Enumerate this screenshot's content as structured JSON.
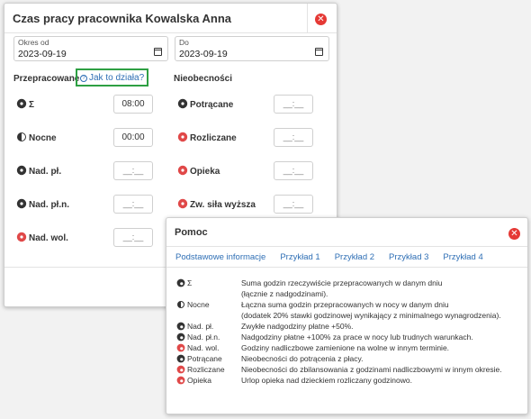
{
  "dialog": {
    "title": "Czas pracy pracownika Kowalska Anna",
    "close_icon": "close-icon",
    "from": {
      "label": "Okres od",
      "value": "2023-09-19"
    },
    "to": {
      "label": "Do",
      "value": "2023-09-19"
    },
    "worked_title": "Przepracowane",
    "help_link": "Jak to działa?",
    "absences_title": "Nieobecności",
    "worked_rows": [
      {
        "label": "Σ",
        "icon": "gear-icon",
        "value": "08:00"
      },
      {
        "label": "Nocne",
        "icon": "half-circle-icon",
        "value": "00:00"
      },
      {
        "label": "Nad. pł.",
        "icon": "gear-icon",
        "value": "__:__"
      },
      {
        "label": "Nad. pł.n.",
        "icon": "gear-icon",
        "value": "__:__"
      },
      {
        "label": "Nad. wol.",
        "icon": "red-gear-icon",
        "value": "__:__"
      }
    ],
    "absence_rows": [
      {
        "label": "Potrącane",
        "icon": "gear-icon",
        "value": "__:__"
      },
      {
        "label": "Rozliczane",
        "icon": "red-gear-icon",
        "value": "__:__"
      },
      {
        "label": "Opieka",
        "icon": "red-gear-icon",
        "value": "__:__"
      },
      {
        "label": "Zw. siła wyższa",
        "icon": "red-gear-icon",
        "value": "__:__"
      }
    ]
  },
  "help": {
    "title": "Pomoc",
    "tabs": [
      "Podstawowe informacje",
      "Przykład 1",
      "Przykład 2",
      "Przykład 3",
      "Przykład 4"
    ],
    "rows": [
      {
        "term": "Σ",
        "icon": "gear-icon",
        "desc": "Suma godzin rzeczywiście przepracowanych w danym dniu",
        "desc2": "(łącznie z nadgodzinami)."
      },
      {
        "term": "Nocne",
        "icon": "half-circle-icon",
        "desc": "Łączna suma godzin przepracowanych w nocy w danym dniu",
        "desc2": "(dodatek 20% stawki godzinowej wynikający z minimalnego wynagrodzenia)."
      },
      {
        "term": "Nad. pł.",
        "icon": "gear-icon",
        "desc": "Zwykłe nadgodziny płatne +50%."
      },
      {
        "term": "Nad. pł.n.",
        "icon": "gear-icon",
        "desc": "Nadgodziny płatne +100% za prace w nocy lub trudnych warunkach."
      },
      {
        "term": "Nad. wol.",
        "icon": "red-gear-icon",
        "desc": "Godziny nadliczbowe zamienione na wolne w innym terminie."
      },
      {
        "term": "Potrącane",
        "icon": "gear-icon",
        "desc": "Nieobecności do potrącenia z płacy."
      },
      {
        "term": "Rozliczane",
        "icon": "red-gear-icon",
        "desc": "Nieobecności do zbilansowania z godzinami nadliczbowymi w innym okresie."
      },
      {
        "term": "Opieka",
        "icon": "red-gear-icon",
        "desc": "Urlop opieka nad dzieckiem rozliczany godzinowo."
      }
    ]
  },
  "colors": {
    "link": "#2f6fb5",
    "close": "#e53935",
    "highlight": "#2ea043",
    "red_icon": "#e04848"
  }
}
